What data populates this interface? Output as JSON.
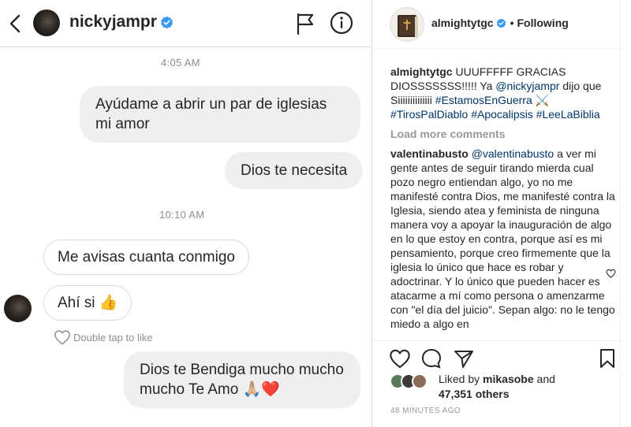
{
  "dm": {
    "username": "nickyjampr",
    "messages": [
      {
        "time": "4:05 AM"
      },
      {
        "text": "Ayúdame a abrir un par de iglesias mi amor"
      },
      {
        "text": "Dios te necesita"
      },
      {
        "time": "10:10 AM"
      },
      {
        "text": "Me avisas cuanta conmigo"
      },
      {
        "text": "Ahí si 👍"
      },
      {
        "text": "Dios te Bendiga mucho mucho mucho Te Amo 🙏🏼❤️"
      }
    ],
    "like_hint": "Double tap to like"
  },
  "post": {
    "username": "almightytgc",
    "following": "Following",
    "caption": {
      "user": "almightytgc",
      "text_1": "UUUFFFFF GRACIAS DIOSSSSSSS!!!!! Ya",
      "mention": "@nickyjampr",
      "text_2": "dijo que Siiiiiiiiiiiiii",
      "tags": [
        "#EstamosEnGuerra",
        "#TirosPalDiablo",
        "#Apocalipsis",
        "#LeeLaBiblia"
      ],
      "emoji": "⚔️"
    },
    "load_more": "Load more comments",
    "comment": {
      "user": "valentinabusto",
      "mention": "@valentinabusto",
      "text": "a ver mi gente antes de seguir tirando mierda cual pozo negro entiendan algo, yo no me manifesté contra Dios, me manifesté contra la Iglesia, siendo atea y feminista de ninguna manera voy a apoyar la inauguración de algo en lo que estoy en contra, porque así es mi pensamiento, porque creo firmemente que la iglesia lo único que hace es robar y adoctrinar. Y lo único que pueden hacer es atacarme a mí como persona o amenzarme con \"el día del juicio\". Sepan algo: no le tengo miedo a algo en"
    },
    "likes": {
      "prefix": "Liked by",
      "user": "mikasobe",
      "and": "and",
      "count": "47,351 others"
    },
    "time_ago": "48 MINUTES AGO"
  },
  "colors": {
    "verified": "#3897f0",
    "link": "#003569",
    "bubble_out": "#efefef",
    "border": "#dbdbdb",
    "muted": "#8e8e8e"
  }
}
